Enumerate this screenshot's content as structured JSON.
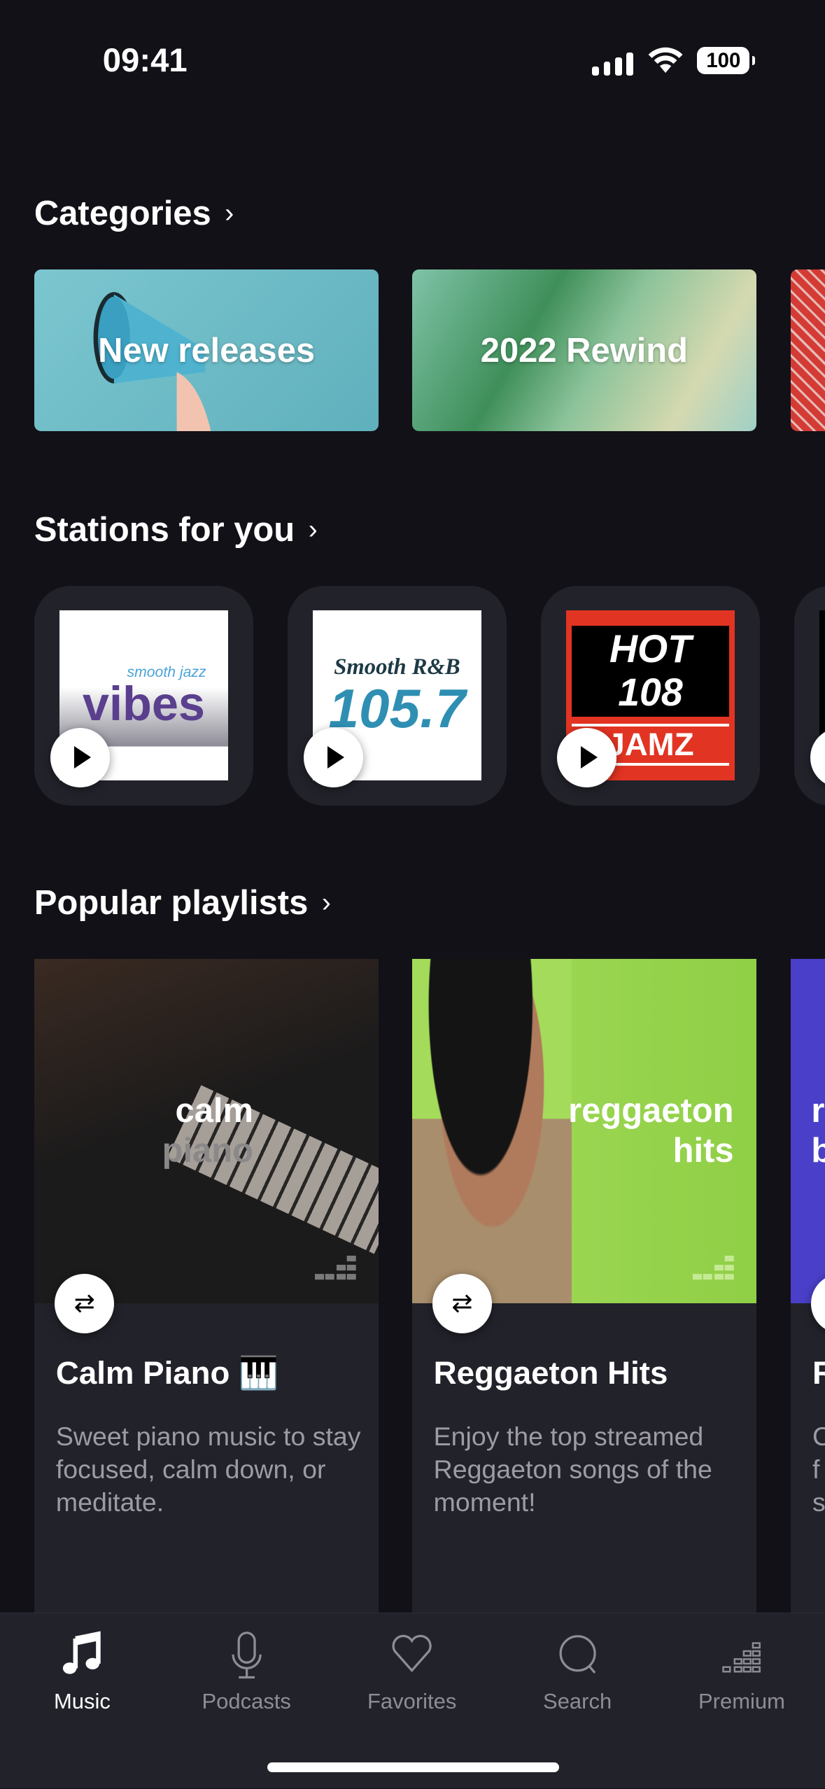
{
  "status": {
    "time": "09:41",
    "battery": "100"
  },
  "sections": {
    "categories": {
      "title": "Categories",
      "chevron": "›",
      "items": [
        {
          "label": "New releases",
          "color": "#6bbac4"
        },
        {
          "label": "2022 Rewind",
          "color": "#6fae8a"
        },
        {
          "label": "",
          "color": "#d43b35"
        }
      ]
    },
    "stations": {
      "title": "Stations for you",
      "chevron": "›",
      "items": [
        {
          "logo_text": "vibes",
          "logo_sub": "smooth jazz"
        },
        {
          "logo_text": "105.7",
          "logo_sub": "Smooth R&B"
        },
        {
          "logo_text": "HOT 108",
          "logo_sub": "JAMZ"
        },
        {
          "logo_text": "",
          "logo_sub": ""
        }
      ]
    },
    "playlists": {
      "title": "Popular playlists",
      "chevron": "›",
      "items": [
        {
          "title": "Calm Piano 🎹",
          "description": "Sweet piano music to stay focused, calm down, or meditate.",
          "cover_line1": "calm",
          "cover_line2": "piano",
          "cover_color": "#1c1b1b"
        },
        {
          "title": "Reggaeton Hits",
          "description": "Enjoy the top streamed Reggaeton songs of the moment!",
          "cover_line1": "reggaeton",
          "cover_line2": "hits",
          "cover_color": "#a4db5a"
        },
        {
          "title": "R",
          "description": "C f s",
          "cover_line1": "r",
          "cover_line2": "b",
          "cover_color": "#4a3fc8"
        }
      ]
    }
  },
  "tabs": [
    {
      "label": "Music",
      "icon": "music-note-icon",
      "active": true
    },
    {
      "label": "Podcasts",
      "icon": "microphone-icon"
    },
    {
      "label": "Favorites",
      "icon": "heart-icon"
    },
    {
      "label": "Search",
      "icon": "search-icon"
    },
    {
      "label": "Premium",
      "icon": "equalizer-icon"
    }
  ]
}
